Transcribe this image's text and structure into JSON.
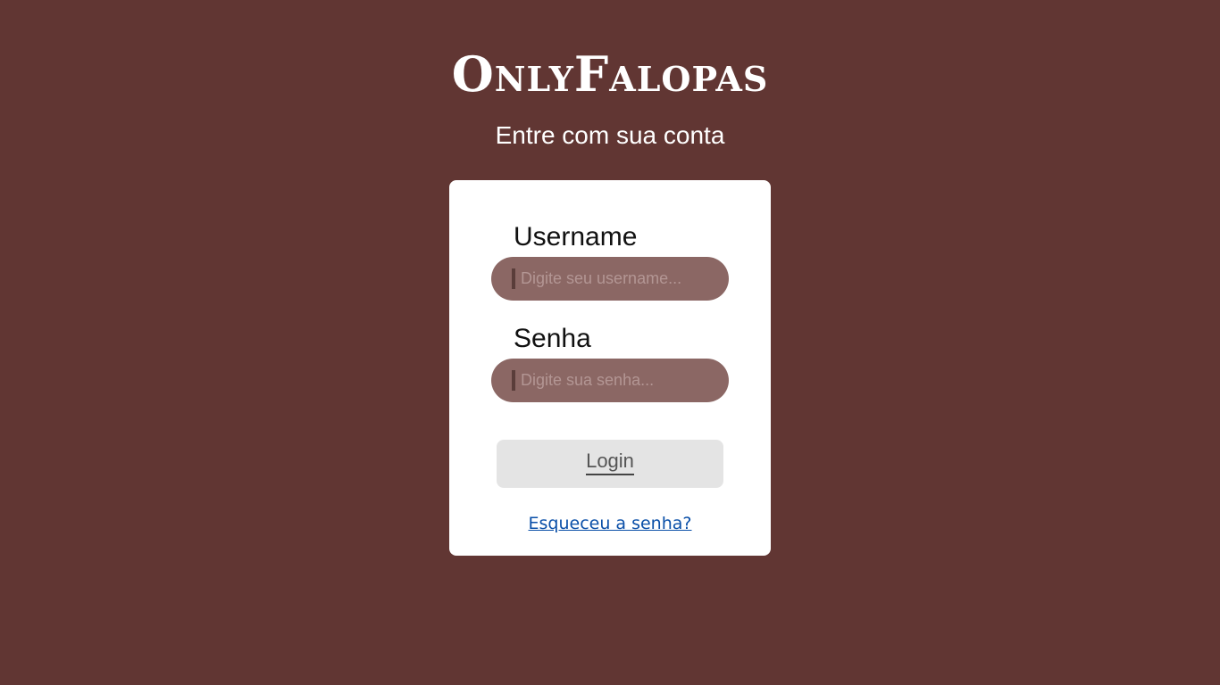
{
  "header": {
    "brand": "OnlyFalopas",
    "subtitle": "Entre com sua conta"
  },
  "form": {
    "username": {
      "label": "Username",
      "placeholder": "Digite seu username...",
      "value": ""
    },
    "password": {
      "label": "Senha",
      "placeholder": "Digite sua senha...",
      "value": ""
    },
    "login_label": "Login",
    "forgot_link": "Esqueceu a senha?"
  },
  "colors": {
    "background": "#613633",
    "card": "#ffffff",
    "input_fill": "#8b6764",
    "button_fill": "#e4e4e4",
    "link": "#0a4fa8"
  }
}
